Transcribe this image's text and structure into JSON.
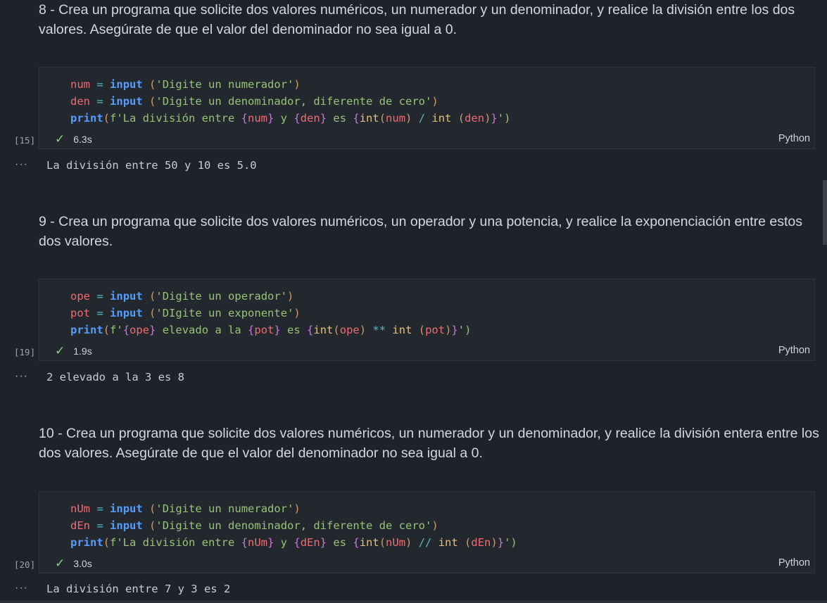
{
  "sections": [
    {
      "markdown": "8 - Crea un programa que solicite dos valores numéricos, un numerador y un denominador, y realice la división entre los dos valores. Asegúrate de que el valor del denominador no sea igual a 0.",
      "exec_count": "[15]",
      "duration": "6.3s",
      "language": "Python",
      "code": {
        "l1": {
          "var": "num",
          "eq": "=",
          "fn": "input",
          "open": "(",
          "str": "'Digite un numerador'",
          "close": ")"
        },
        "l2": {
          "var": "den",
          "eq": "=",
          "fn": "input",
          "open": "(",
          "str": "'Digite un denominador, diferente de cero'",
          "close": ")"
        },
        "l3": {
          "fn": "print",
          "open": "(",
          "prefix": "f'La división entre ",
          "a": "num",
          "mid1": " y ",
          "b": "den",
          "mid2": " es ",
          "expr1": "int",
          "p1": "(",
          "v1": "num",
          "p2": ")",
          "op": " / ",
          "expr2": "int",
          "p3": " (",
          "v2": "den",
          "p4": ")",
          "end": "')"
        }
      },
      "output": "La división entre 50 y 10 es 5.0"
    },
    {
      "markdown": "9 - Crea un programa que solicite dos valores numéricos, un operador y una potencia, y realice la exponenciación entre estos dos valores.",
      "exec_count": "[19]",
      "duration": "1.9s",
      "language": "Python",
      "code": {
        "l1": {
          "var": "ope",
          "eq": "=",
          "fn": "input",
          "open": "(",
          "str": "'Digite un operador'",
          "close": ")"
        },
        "l2": {
          "var": "pot",
          "eq": "=",
          "fn": "input",
          "open": "(",
          "str": "'DIgite un exponente'",
          "close": ")"
        },
        "l3": {
          "fn": "print",
          "open": "(",
          "prefix": "f'",
          "a": "ope",
          "mid1": " elevado a la ",
          "b": "pot",
          "mid2": " es ",
          "expr1": "int",
          "p1": "(",
          "v1": "ope",
          "p2": ")",
          "op": " ** ",
          "expr2": "int",
          "p3": " (",
          "v2": "pot",
          "p4": ")",
          "end": "')"
        }
      },
      "output": "2 elevado a la 3 es 8"
    },
    {
      "markdown": "10 - Crea un programa que solicite dos valores numéricos, un numerador y un denominador, y realice la división entera entre los dos valores. Asegúrate de que el valor del denominador no sea igual a 0.",
      "exec_count": "[20]",
      "duration": "3.0s",
      "language": "Python",
      "code": {
        "l1": {
          "var": "nUm",
          "eq": "=",
          "fn": "input",
          "open": "(",
          "str": "'Digite un numerador'",
          "close": ")"
        },
        "l2": {
          "var": "dEn",
          "eq": "=",
          "fn": "input",
          "open": "(",
          "str": "'Digite un denominador, diferente de cero'",
          "close": ")"
        },
        "l3": {
          "fn": "print",
          "open": "(",
          "prefix": "f'La división entre ",
          "a": "nUm",
          "mid1": " y ",
          "b": "dEn",
          "mid2": " es ",
          "expr1": "int",
          "p1": "(",
          "v1": "nUm",
          "p2": ")",
          "op": " // ",
          "expr2": "int",
          "p3": " (",
          "v2": "dEn",
          "p4": ")",
          "end": "')"
        }
      },
      "output": "La división entre 7 y 3 es 2"
    }
  ],
  "ui": {
    "output_dots": "···",
    "check_icon": "check-icon",
    "colors": {
      "background": "#1f2228",
      "cell": "#23272e",
      "check": "#89d185",
      "keyword": "#569cff",
      "variable": "#ef6b73",
      "string": "#98c379"
    }
  }
}
